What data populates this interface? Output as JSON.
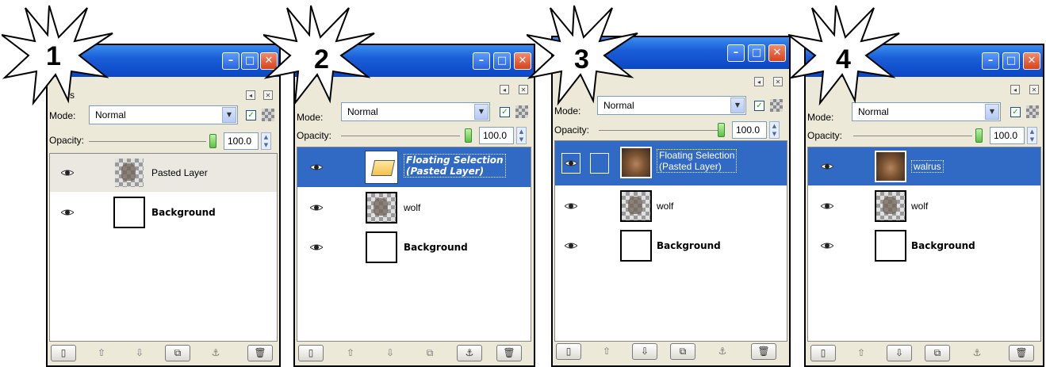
{
  "window": {
    "close_glyph": "✕",
    "maximize_glyph": "□",
    "minimize_glyph": "–"
  },
  "colors": {
    "titlebar": "#0a47c4",
    "selection": "#316ac5",
    "panel": "#ece9d8"
  },
  "icons": {
    "eye": "eye-icon",
    "new": "new-layer-icon",
    "raise": "raise-layer-icon",
    "lower": "lower-layer-icon",
    "duplicate": "duplicate-layer-icon",
    "anchor": "anchor-icon",
    "delete": "delete-icon"
  },
  "panels": [
    {
      "step": "1",
      "tab_fragment": "s",
      "mode_label": "Mode:",
      "mode_value": "Normal",
      "opacity_label": "Opacity:",
      "opacity_value": "100.0",
      "layers": [
        {
          "name": "Pasted Layer"
        },
        {
          "name": "Background"
        }
      ]
    },
    {
      "step": "2",
      "mode_label": "Mode:",
      "mode_value": "Normal",
      "opacity_label": "Opacity:",
      "opacity_value": "100.0",
      "layers": [
        {
          "name_line1": "Floating Selection",
          "name_line2": "(Pasted Layer)"
        },
        {
          "name": "wolf"
        },
        {
          "name": "Background"
        }
      ]
    },
    {
      "step": "3",
      "mode_label": "Mode:",
      "mode_value": "Normal",
      "opacity_label": "Opacity:",
      "opacity_value": "100.0",
      "layers": [
        {
          "name_line1": "Floating Selection",
          "name_line2": "(Pasted Layer)"
        },
        {
          "name": "wolf"
        },
        {
          "name": "Background"
        }
      ]
    },
    {
      "step": "4",
      "mode_label": "Mode:",
      "mode_value": "Normal",
      "opacity_label": "Opacity:",
      "opacity_value": "100.0",
      "layers": [
        {
          "name": "walrus"
        },
        {
          "name": "wolf"
        },
        {
          "name": "Background"
        }
      ]
    }
  ],
  "button_glyphs": {
    "new": "▯",
    "raise": "⇧",
    "lower": "⇩",
    "duplicate": "⧉",
    "anchor": "⚓",
    "delete": "🗑"
  }
}
